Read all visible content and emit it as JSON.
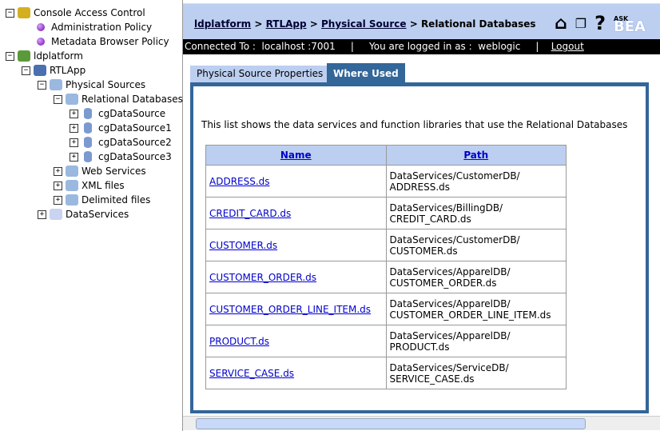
{
  "tree": [
    {
      "label": "Console Access Control",
      "toggle": "−",
      "kind": "lock"
    },
    {
      "label": "Administration Policy",
      "kind": "ball"
    },
    {
      "label": "Metadata Browser Policy",
      "kind": "ball"
    },
    {
      "label": "ldplatform",
      "toggle": "−",
      "kind": "globe"
    },
    {
      "label": "RTLApp",
      "toggle": "−",
      "kind": "app"
    },
    {
      "label": "Physical Sources",
      "toggle": "−",
      "kind": "folder"
    },
    {
      "label": "Relational Databases",
      "toggle": "−",
      "kind": "db-folder"
    },
    {
      "label": "cgDataSource",
      "toggle": "+",
      "kind": "db"
    },
    {
      "label": "cgDataSource1",
      "toggle": "+",
      "kind": "db"
    },
    {
      "label": "cgDataSource2",
      "toggle": "+",
      "kind": "db"
    },
    {
      "label": "cgDataSource3",
      "toggle": "+",
      "kind": "db"
    },
    {
      "label": "Web Services",
      "toggle": "+",
      "kind": "folder"
    },
    {
      "label": "XML files",
      "toggle": "+",
      "kind": "folder"
    },
    {
      "label": "Delimited files",
      "toggle": "+",
      "kind": "folder"
    },
    {
      "label": "DataServices",
      "toggle": "+",
      "kind": "plain-folder"
    }
  ],
  "breadcrumb": {
    "l1": "ldplatform",
    "l2": "RTLApp",
    "l3": "Physical Source",
    "current": "Relational Databases",
    "sep": " > "
  },
  "header": {
    "ask": "ASK",
    "bea": "BEA"
  },
  "status": {
    "connected": "Connected To :  localhost :7001     |     You are logged in as :  weblogic     |    ",
    "logout": "Logout"
  },
  "tabs": [
    "Physical Source Properties",
    "Where Used"
  ],
  "description": "This list shows the data services and function libraries that use the Relational Databases",
  "table": {
    "headers": [
      "Name",
      "Path"
    ],
    "rows": [
      [
        "ADDRESS.ds",
        "DataServices/CustomerDB/",
        "ADDRESS.ds"
      ],
      [
        "CREDIT_CARD.ds",
        "DataServices/BillingDB/",
        "CREDIT_CARD.ds"
      ],
      [
        "CUSTOMER.ds",
        "DataServices/CustomerDB/",
        "CUSTOMER.ds"
      ],
      [
        "CUSTOMER_ORDER.ds",
        "DataServices/ApparelDB/",
        "CUSTOMER_ORDER.ds"
      ],
      [
        "CUSTOMER_ORDER_LINE_ITEM.ds",
        "DataServices/ApparelDB/",
        "CUSTOMER_ORDER_LINE_ITEM.ds"
      ],
      [
        "PRODUCT.ds",
        "DataServices/ApparelDB/",
        "PRODUCT.ds"
      ],
      [
        "SERVICE_CASE.ds",
        "DataServices/ServiceDB/",
        "SERVICE_CASE.ds"
      ]
    ]
  }
}
